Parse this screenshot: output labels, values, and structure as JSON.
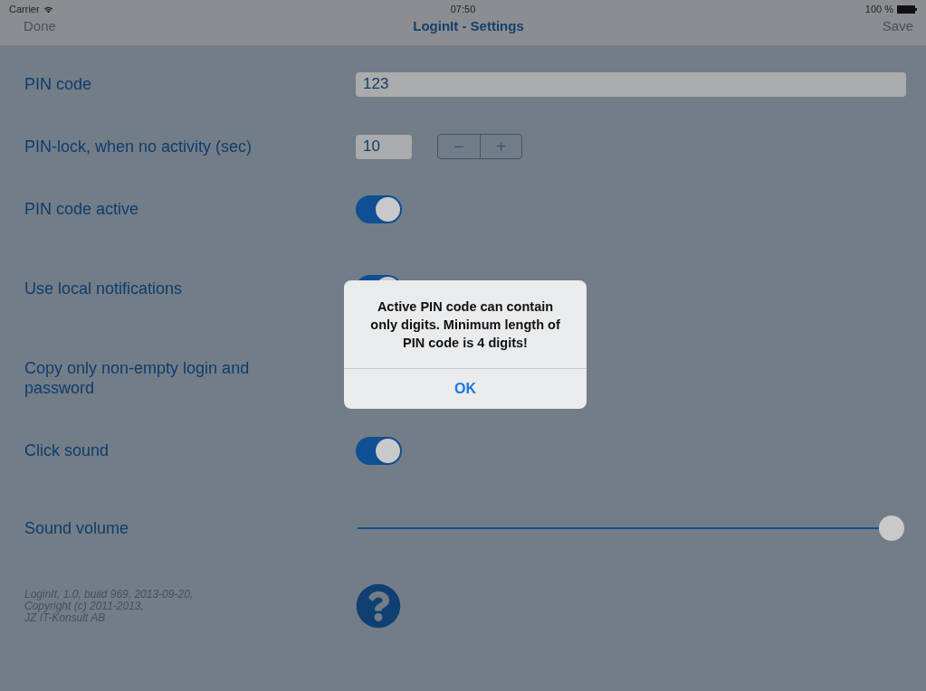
{
  "status_bar": {
    "carrier": "Carrier",
    "time": "07:50",
    "battery": "100 %"
  },
  "nav_bar": {
    "left": "Done",
    "title": "LoginIt - Settings",
    "right": "Save"
  },
  "settings": [
    {
      "kind": "text",
      "label": "PIN code",
      "value": "123"
    },
    {
      "kind": "stepper",
      "label": "PIN-lock, when no activity (sec)",
      "value": "10",
      "minus": "−",
      "plus": "+"
    },
    {
      "kind": "switch",
      "label": "PIN code active",
      "on": true
    },
    {
      "kind": "switch",
      "label": "Use local notifications",
      "on": true
    },
    {
      "kind": "plain",
      "label": "Copy only non-empty login and password"
    },
    {
      "kind": "switch",
      "label": "Click sound",
      "on": true
    },
    {
      "kind": "slider",
      "label": "Sound volume",
      "level": 1.0
    }
  ],
  "footer": {
    "lines": [
      "LoginIt, 1.0, build 969, 2013-09-20,",
      "Copyright (c) 2011-2013,",
      "JZ IT-Konsult AB"
    ]
  },
  "alert": {
    "message": "Active PIN code can contain only digits. Minimum length of PIN code is 4 digits!",
    "button": "OK"
  }
}
